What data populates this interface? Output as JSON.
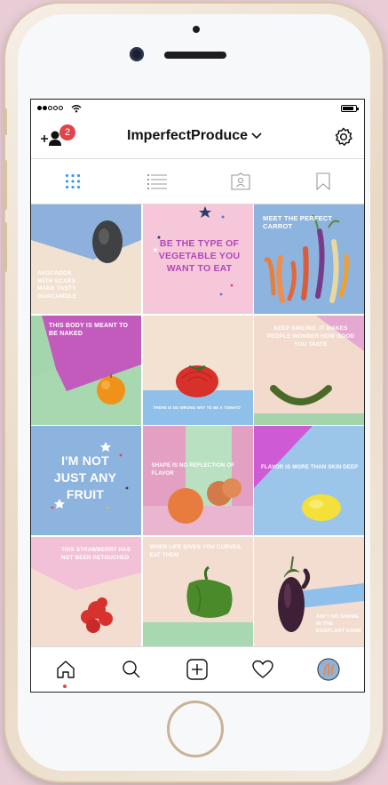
{
  "device": {
    "model": "iPhone",
    "frame_color": "#efe3d2",
    "background": "#e8cdd6"
  },
  "status_bar": {
    "wifi_icon": "wifi-icon",
    "battery_icon": "battery-icon"
  },
  "header": {
    "username": "ImperfectProduce",
    "notification_count": "2",
    "add_user_icon": "add-user-icon",
    "settings_icon": "gear-icon",
    "dropdown_icon": "chevron-down-icon"
  },
  "profile_tabs": [
    {
      "name": "grid",
      "icon": "grid-icon",
      "active": true
    },
    {
      "name": "list",
      "icon": "list-icon",
      "active": false
    },
    {
      "name": "tagged",
      "icon": "tagged-icon",
      "active": false
    },
    {
      "name": "saved",
      "icon": "bookmark-icon",
      "active": false
    }
  ],
  "posts": [
    {
      "caption": "AVOCADOS WITH SCARS MAKE TASTY GUACAMOLE",
      "subject": "avocado"
    },
    {
      "caption": "BE THE TYPE OF VEGETABLE YOU WANT TO EAT",
      "subject": "text"
    },
    {
      "caption": "MEET THE PERFECT CARROT",
      "subject": "carrots"
    },
    {
      "caption": "THIS BODY IS MEANT TO BE NAKED",
      "subject": "orange"
    },
    {
      "caption": "THERE IS NO WRONG WAY TO BE A TOMATO",
      "subject": "tomato"
    },
    {
      "caption": "KEEP SMILING. IT MAKES PEOPLE WONDER HOW GOOD YOU TASTE",
      "subject": "cucumber"
    },
    {
      "caption": "I'M NOT JUST ANY FRUIT",
      "subject": "text"
    },
    {
      "caption": "SHAPE IS NO REFLECTION OF FLAVOR",
      "subject": "onions"
    },
    {
      "caption": "FLAVOR IS MORE THAN SKIN DEEP",
      "subject": "lemon"
    },
    {
      "caption": "THIS STRAWBERRY HAS NOT BEEN RETOUCHED",
      "subject": "strawberry"
    },
    {
      "caption": "WHEN LIFE GIVES YOU CURVES, EAT THEM",
      "subject": "pepper"
    },
    {
      "caption": "AIN'T NO SHAME IN THE EGGPLANT GAME",
      "subject": "eggplant"
    }
  ],
  "bottom_nav": [
    {
      "name": "home",
      "icon": "home-icon"
    },
    {
      "name": "search",
      "icon": "search-icon"
    },
    {
      "name": "new-post",
      "icon": "plus-square-icon"
    },
    {
      "name": "activity",
      "icon": "heart-icon"
    },
    {
      "name": "profile",
      "icon": "avatar"
    }
  ],
  "colors": {
    "badge": "#e0434b",
    "active_tab": "#3897f0",
    "notification_dot": "#e0434b"
  }
}
